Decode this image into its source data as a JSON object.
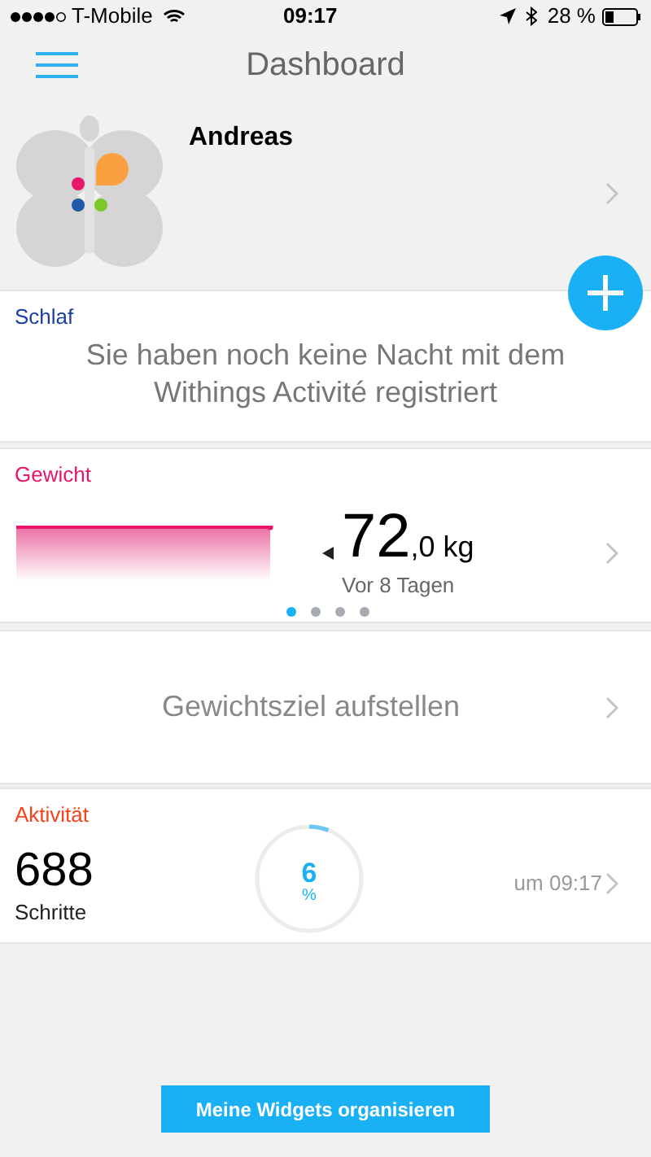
{
  "status_bar": {
    "carrier": "T-Mobile",
    "time": "09:17",
    "battery": "28 %"
  },
  "header": {
    "title": "Dashboard"
  },
  "profile": {
    "name": "Andreas"
  },
  "sleep": {
    "title": "Schlaf",
    "message": "Sie haben noch keine Nacht mit dem Withings Activité registriert"
  },
  "weight": {
    "title": "Gewicht",
    "value": "72",
    "unit": ",0 kg",
    "ago": "Vor 8 Tagen",
    "pages": [
      {
        "selected": true
      },
      {
        "selected": false
      },
      {
        "selected": false
      },
      {
        "selected": false
      }
    ]
  },
  "goal": {
    "label": "Gewichtsziel aufstellen"
  },
  "activity": {
    "title": "Aktivität",
    "steps": "688",
    "steps_label": "Schritte",
    "percent": "6",
    "percent_unit": "%",
    "time": "um 09:17"
  },
  "footer_button": "Meine Widgets organisieren"
}
